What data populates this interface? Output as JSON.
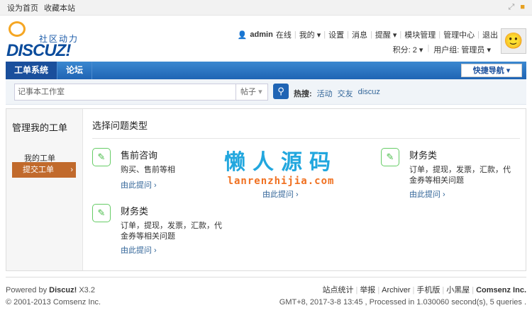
{
  "topbar": {
    "set_home": "设为首页",
    "bookmark": "收藏本站"
  },
  "logo": {
    "slogan": "社区动力",
    "word": "DISCUZ!"
  },
  "user": {
    "name": "admin",
    "status": "在线",
    "links": [
      "我的",
      "设置",
      "消息",
      "提醒",
      "模块管理",
      "管理中心",
      "退出"
    ],
    "points": "积分: 2",
    "group": "用户组: 管理员"
  },
  "nav": {
    "items": [
      "工单系统",
      "论坛"
    ],
    "quick": "快捷导航"
  },
  "search": {
    "value": "记事本工作室",
    "type": "帖子",
    "hot_label": "热搜:",
    "hot": [
      "活动",
      "交友",
      "discuz"
    ]
  },
  "side": {
    "title": "管理我的工单",
    "items": [
      "我的工单",
      "提交工单"
    ]
  },
  "content": {
    "title": "选择问题类型",
    "cards": [
      {
        "title": "售前咨询",
        "desc": "购买、售前等相",
        "link": "由此提问 ›"
      },
      {
        "title": "",
        "desc": "",
        "link": "由此提问 ›"
      },
      {
        "title": "财务类",
        "desc": "订单，提现，发票，汇款，代金券等相关问题",
        "link": "由此提问 ›"
      },
      {
        "title": "财务类",
        "desc": "订单，提现，发票，汇款，代金券等相关问题",
        "link": "由此提问 ›"
      }
    ],
    "watermark_cn": "懒人源码",
    "watermark_en": "lanrenzhijia.com"
  },
  "footer": {
    "powered": "Powered by",
    "brand": "Discuz!",
    "version": "X3.2",
    "copyright": "© 2001-2013 Comsenz Inc.",
    "links": [
      "站点统计",
      "举报",
      "Archiver",
      "手机版",
      "小黑屋",
      "Comsenz Inc."
    ],
    "stats": "GMT+8, 2017-3-8 13:45 , Processed in 1.030060 second(s), 5 queries ."
  }
}
